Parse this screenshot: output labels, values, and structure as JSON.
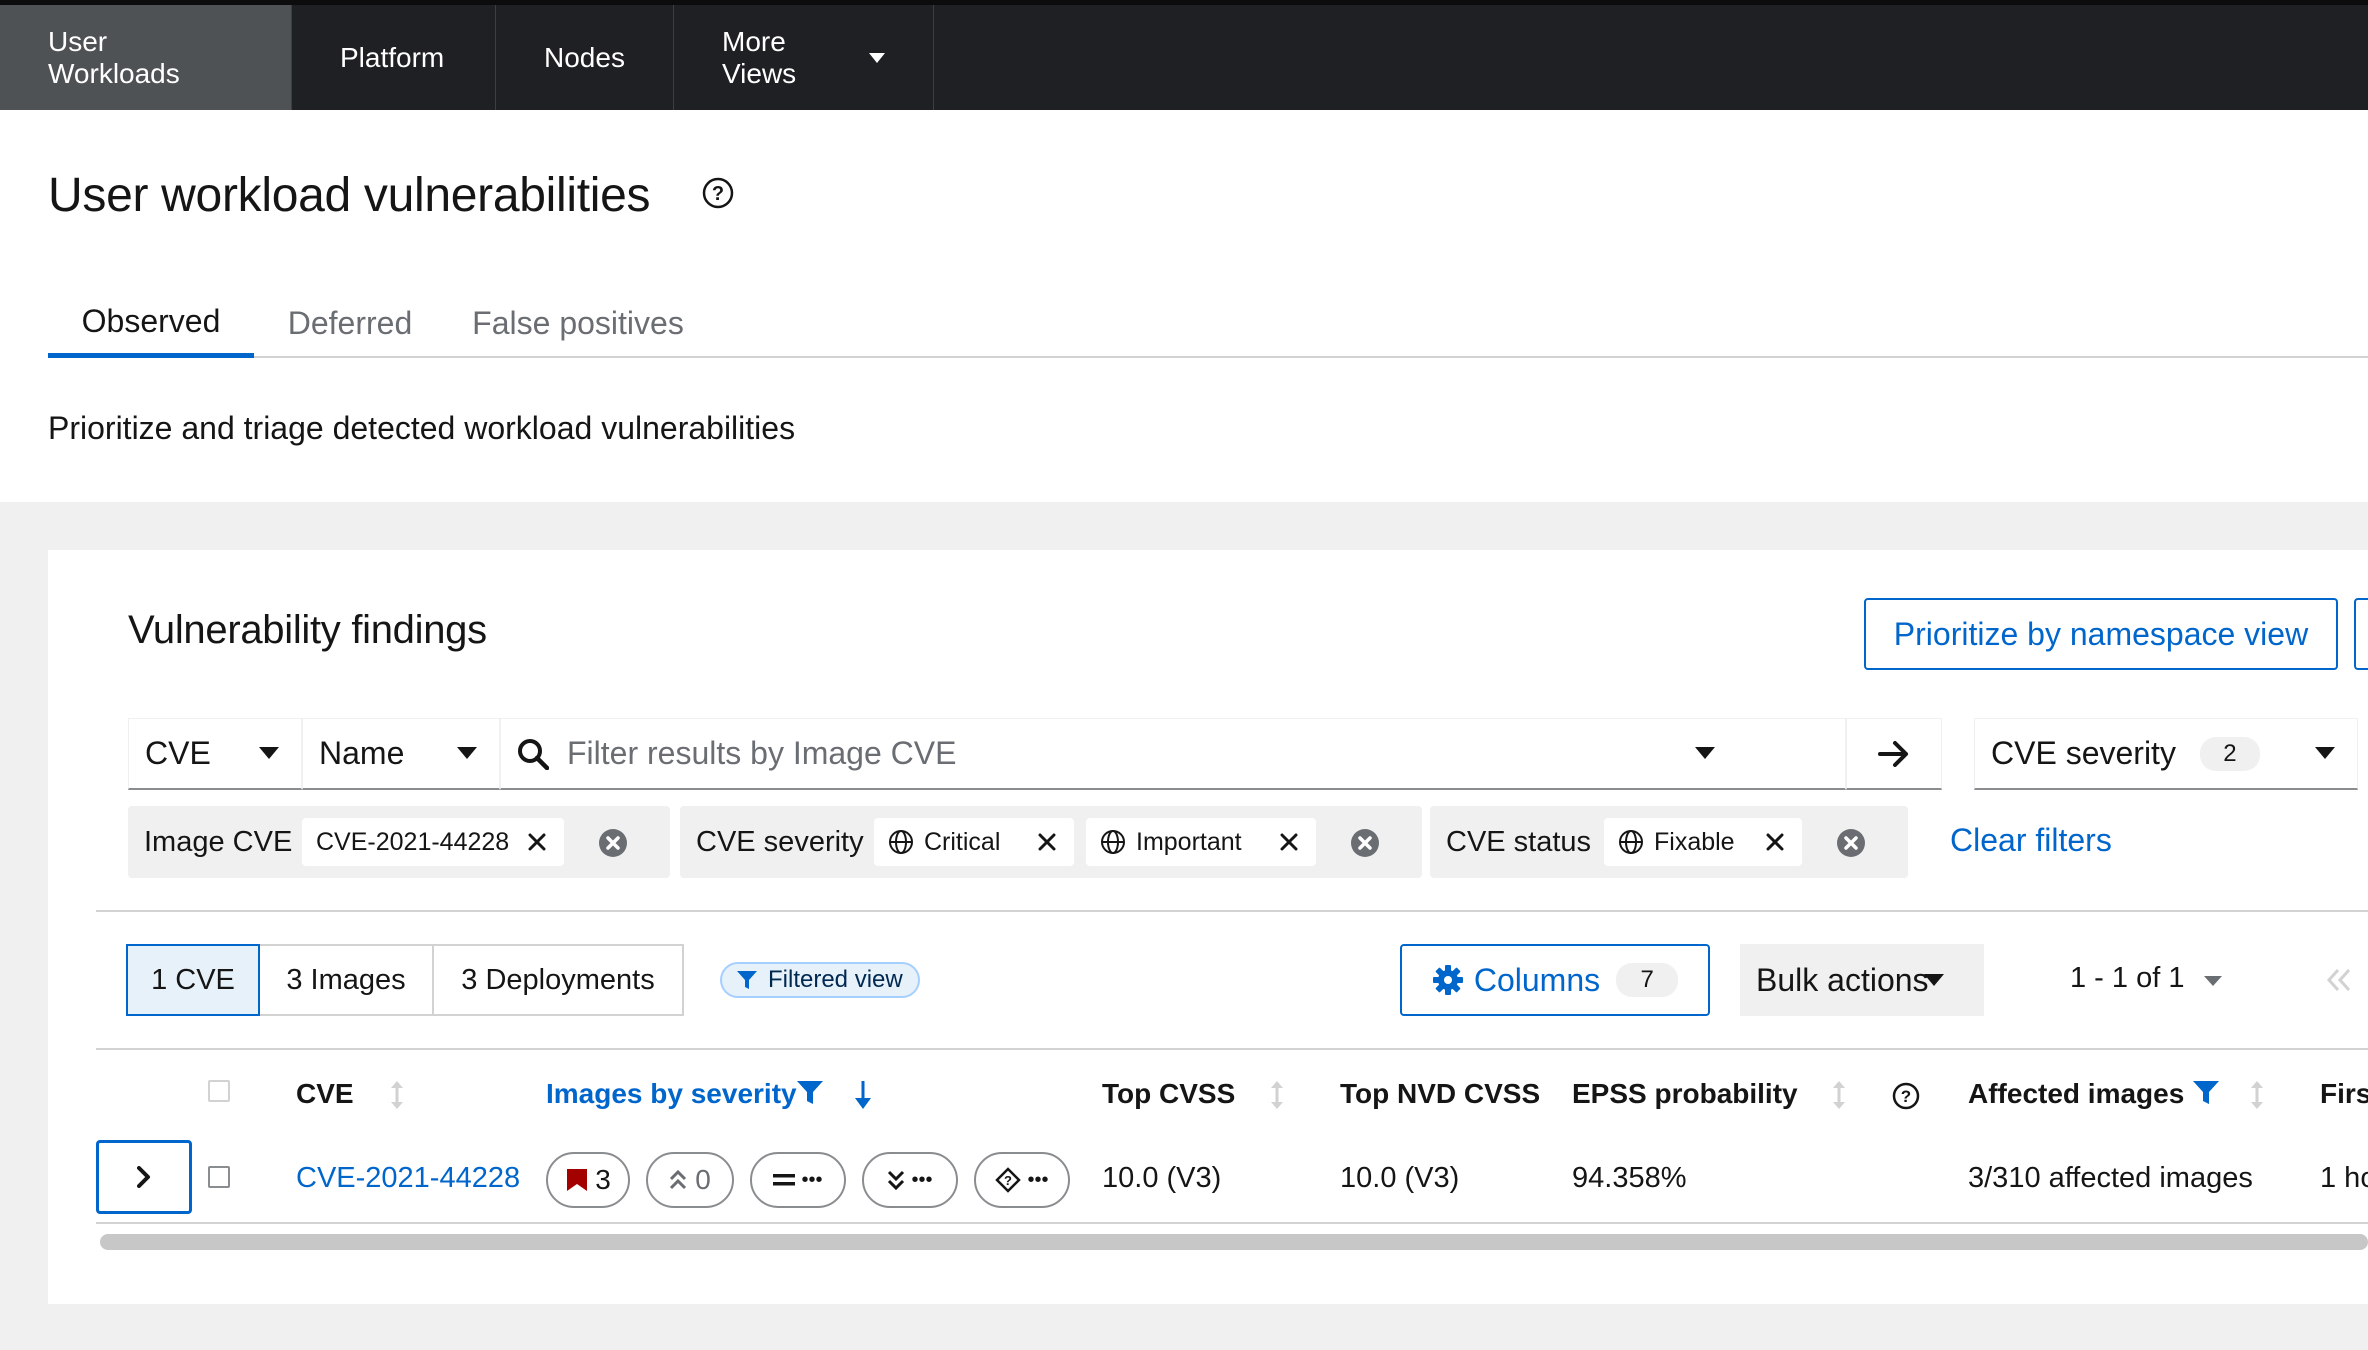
{
  "nav": {
    "tabs": [
      "User Workloads",
      "Platform",
      "Nodes",
      "More Views"
    ]
  },
  "header": {
    "title": "User workload vulnerabilities",
    "tabs": [
      "Observed",
      "Deferred",
      "False positives"
    ],
    "subtitle": "Prioritize and triage detected workload vulnerabilities"
  },
  "card": {
    "title": "Vulnerability findings",
    "namespace_button": "Prioritize by namespace view"
  },
  "filter": {
    "entity_select": "CVE",
    "attribute_select": "Name",
    "search_placeholder": "Filter results by Image CVE",
    "severity_select": "CVE severity",
    "severity_count": "2"
  },
  "chips": {
    "image_cve_label": "Image CVE",
    "image_cve_value": "CVE-2021-44228",
    "severity_label": "CVE severity",
    "severity_values": [
      "Critical",
      "Important"
    ],
    "status_label": "CVE status",
    "status_value": "Fixable",
    "clear": "Clear filters"
  },
  "toolbar": {
    "entity_toggle": [
      "1 CVE",
      "3 Images",
      "3 Deployments"
    ],
    "filtered_view": "Filtered view",
    "columns_label": "Columns",
    "columns_count": "7",
    "bulk_actions": "Bulk actions",
    "pagination": "1 - 1 of 1"
  },
  "table": {
    "headers": [
      "CVE",
      "Images by severity",
      "Top CVSS",
      "Top NVD CVSS",
      "EPSS probability",
      "Affected images",
      "Firs"
    ],
    "row": {
      "cve": "CVE-2021-44228",
      "critical": "3",
      "important": "0",
      "moderate": "•••",
      "low": "•••",
      "unknown": "•••",
      "top_cvss": "10.0 (V3)",
      "top_nvd_cvss": "10.0 (V3)",
      "epss": "94.358%",
      "affected_images": "3/310 affected images",
      "first": "1 ho"
    }
  },
  "colors": {
    "accent": "#0066cc",
    "critical": "#a30000",
    "nav_bg": "#1f2023"
  }
}
